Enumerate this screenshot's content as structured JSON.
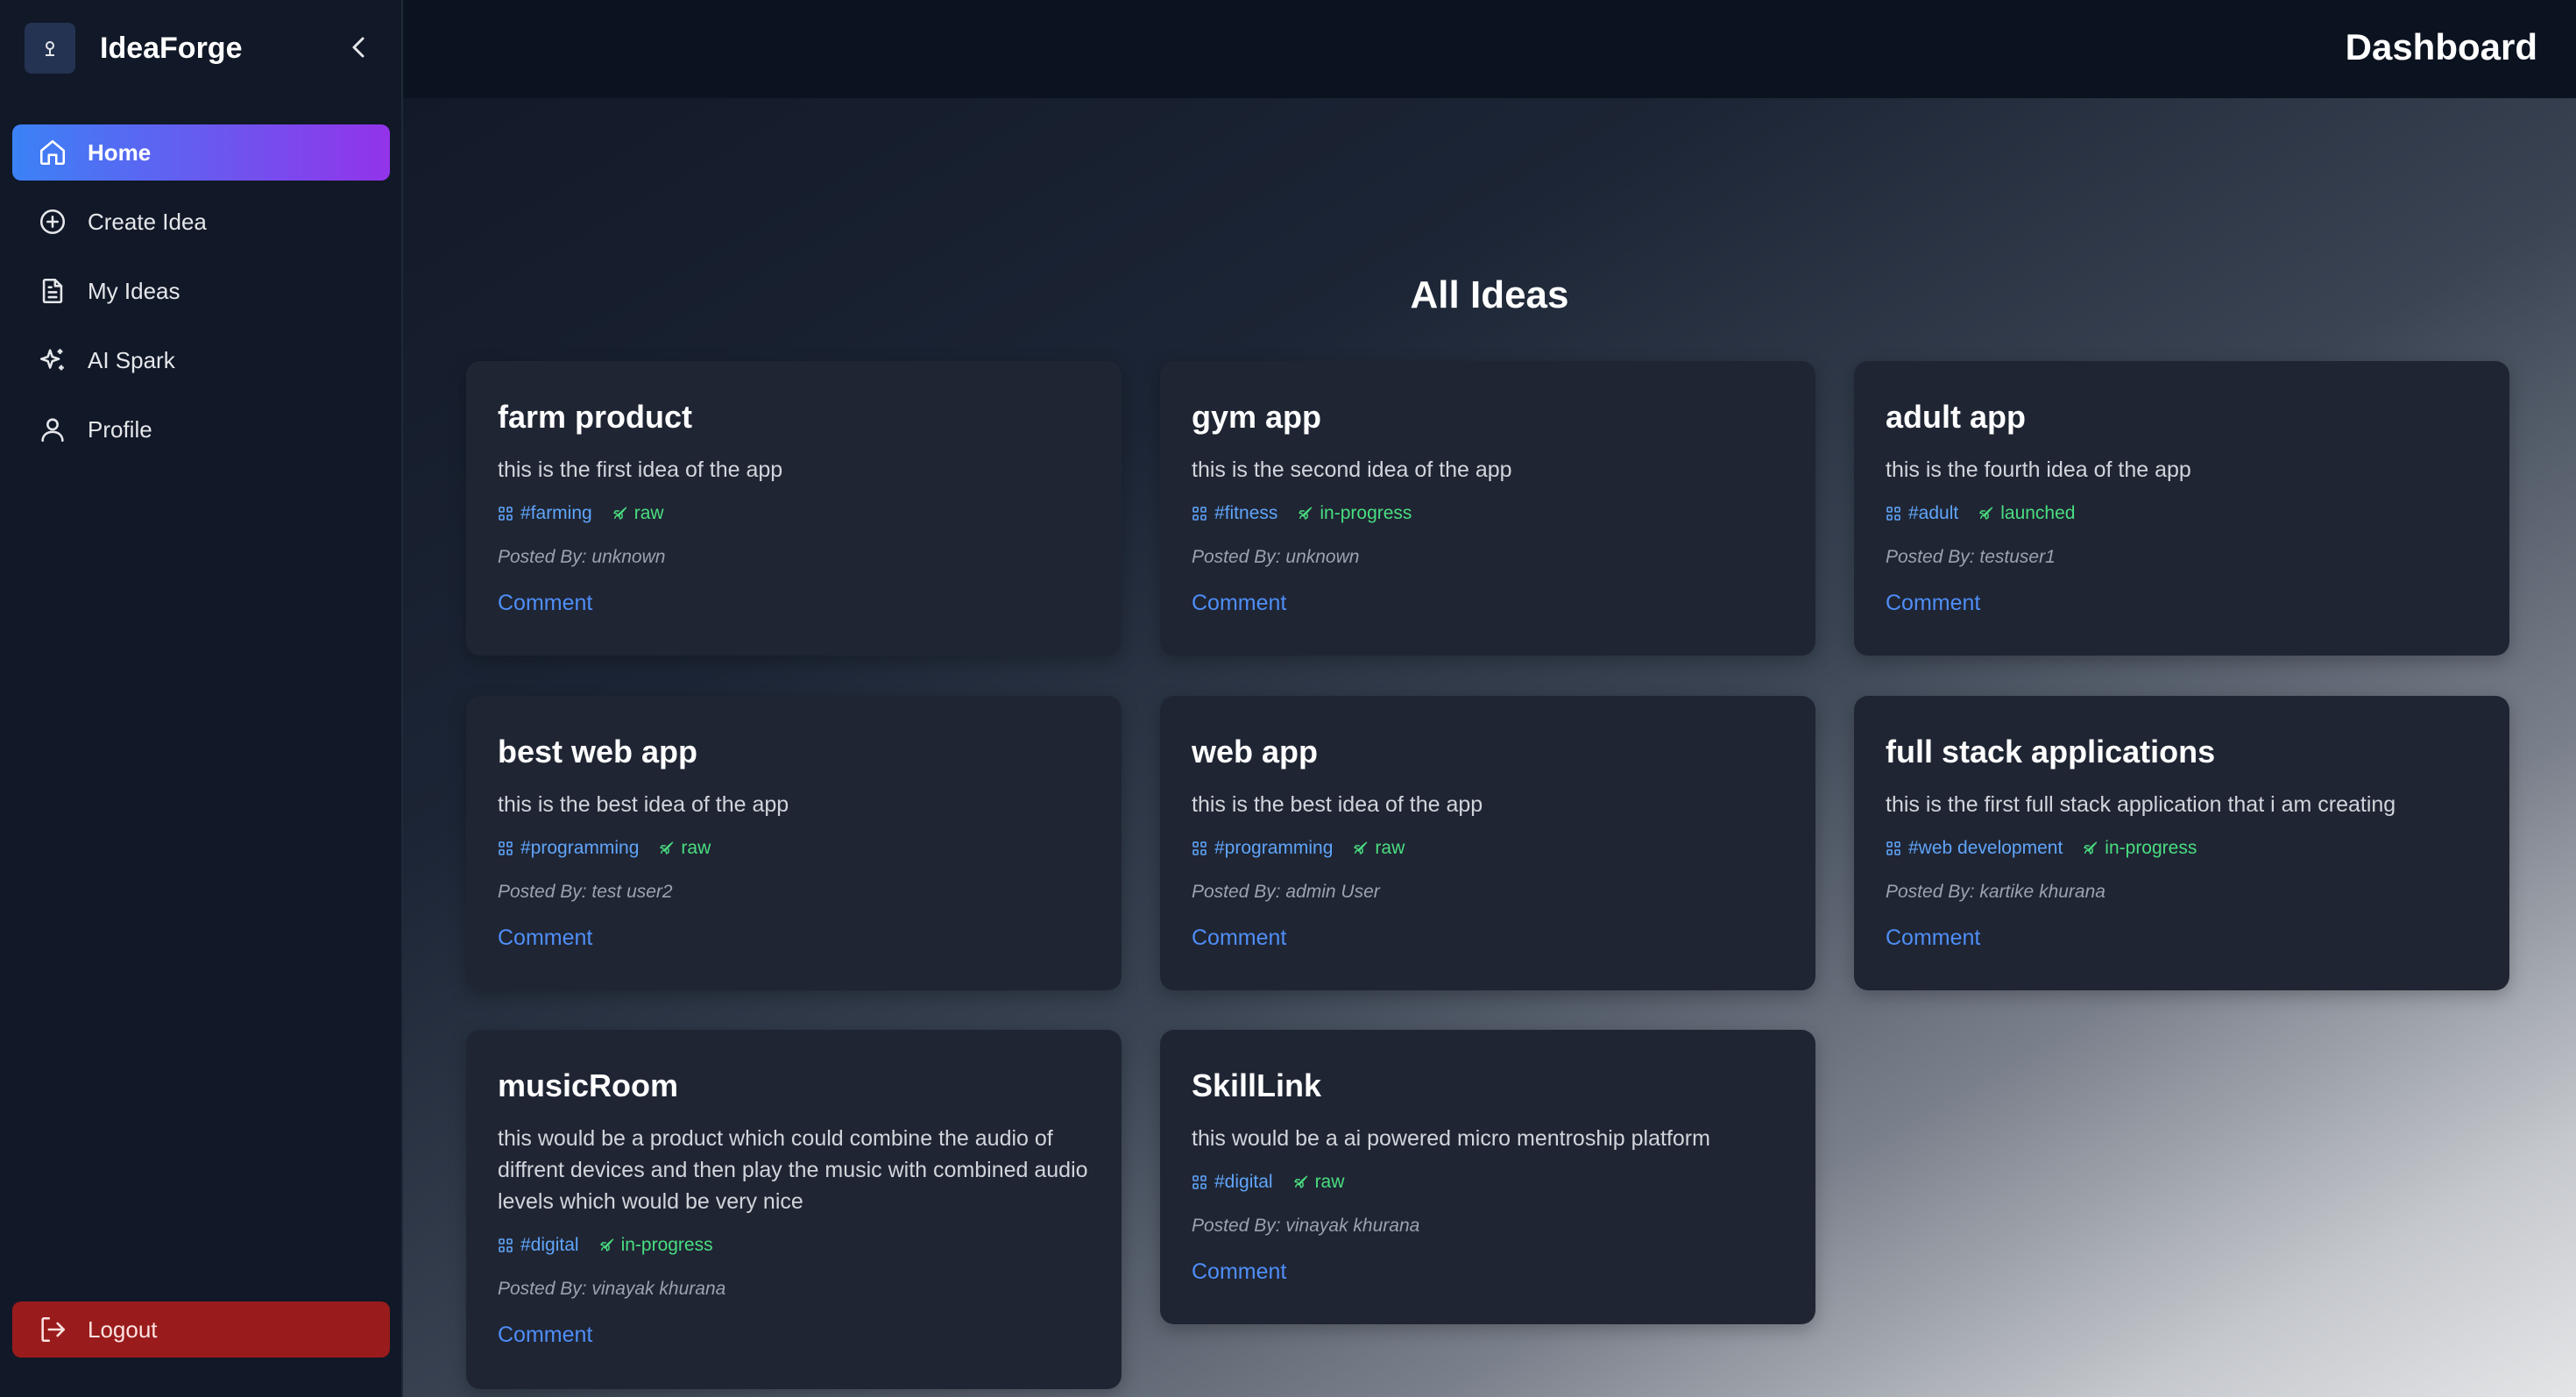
{
  "app": {
    "name": "IdeaForge"
  },
  "sidebar": {
    "items": [
      {
        "label": "Home",
        "icon": "home-icon",
        "active": true
      },
      {
        "label": "Create Idea",
        "icon": "plus-circle-icon",
        "active": false
      },
      {
        "label": "My Ideas",
        "icon": "document-icon",
        "active": false
      },
      {
        "label": "AI Spark",
        "icon": "sparkles-icon",
        "active": false
      },
      {
        "label": "Profile",
        "icon": "user-icon",
        "active": false
      }
    ],
    "logout_label": "Logout"
  },
  "header": {
    "title": "Dashboard"
  },
  "main": {
    "section_title": "All Ideas",
    "ideas": [
      {
        "title": "farm product",
        "description": "this is the first idea of the app",
        "category": "#farming",
        "status": "raw",
        "posted_by": "Posted By: unknown",
        "comment_label": "Comment"
      },
      {
        "title": "gym app",
        "description": "this is the second idea of the app",
        "category": "#fitness",
        "status": "in-progress",
        "posted_by": "Posted By: unknown",
        "comment_label": "Comment"
      },
      {
        "title": "adult app",
        "description": "this is the fourth idea of the app",
        "category": "#adult",
        "status": "launched",
        "posted_by": "Posted By: testuser1",
        "comment_label": "Comment"
      },
      {
        "title": "best web app",
        "description": "this is the best idea of the app",
        "category": "#programming",
        "status": "raw",
        "posted_by": "Posted By: test user2",
        "comment_label": "Comment"
      },
      {
        "title": "web app",
        "description": "this is the best idea of the app",
        "category": "#programming",
        "status": "raw",
        "posted_by": "Posted By: admin User",
        "comment_label": "Comment"
      },
      {
        "title": "full stack applications",
        "description": "this is the first full stack application that i am creating",
        "category": "#web development",
        "status": "in-progress",
        "posted_by": "Posted By: kartike khurana",
        "comment_label": "Comment"
      },
      {
        "title": "musicRoom",
        "description": "this would be a product which could combine the audio of diffrent devices and then play the music with combined audio levels which would be very nice",
        "category": "#digital",
        "status": "in-progress",
        "posted_by": "Posted By: vinayak khurana",
        "comment_label": "Comment"
      },
      {
        "title": "SkillLink",
        "description": "this would be a ai powered micro mentroship platform",
        "category": "#digital",
        "status": "raw",
        "posted_by": "Posted By: vinayak khurana",
        "comment_label": "Comment"
      }
    ]
  },
  "colors": {
    "accent_gradient_start": "#3b82f6",
    "accent_gradient_end": "#9333ea",
    "category_tag": "#60a5fa",
    "status_tag": "#4ade80",
    "logout": "#991b1b",
    "link": "#4f8ef7"
  }
}
